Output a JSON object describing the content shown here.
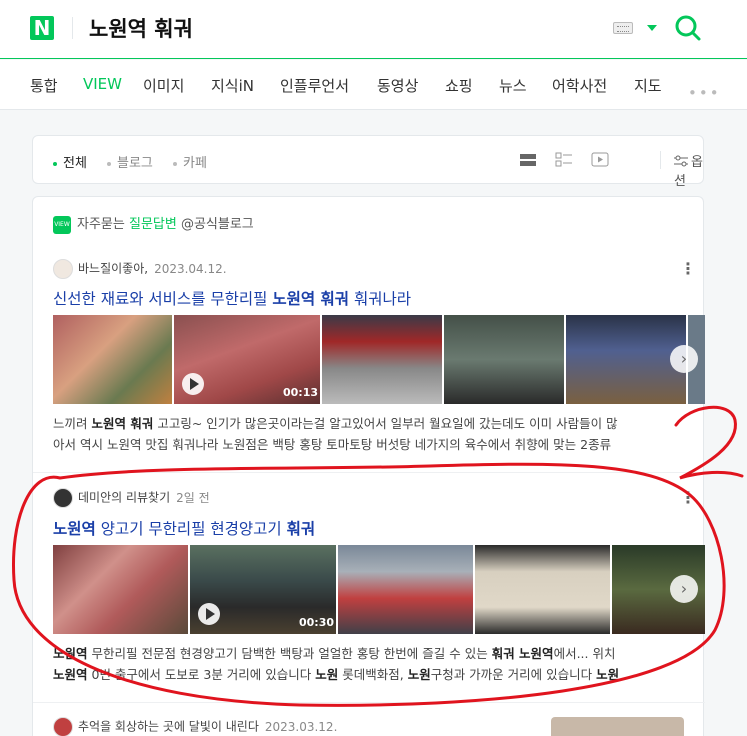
{
  "header": {
    "logo": "N",
    "query": "노원역 훠궈"
  },
  "tabs": [
    "통합",
    "VIEW",
    "이미지",
    "지식iN",
    "인플루언서",
    "동영상",
    "쇼핑",
    "뉴스",
    "어학사전",
    "지도"
  ],
  "tabs_more": "•••",
  "filters": {
    "items": [
      "전체",
      "블로그",
      "카페"
    ],
    "options_label": "옵션"
  },
  "faq": {
    "badge": "VIEW",
    "prefix": "자주묻는",
    "highlight": "질문답변",
    "suffix": "@공식블로그"
  },
  "results": [
    {
      "author": "바느질이좋아,",
      "date": "2023.04.12.",
      "title_pre": "신선한 재료와 서비스를 무한리필 ",
      "title_hl": "노원역 훠궈",
      "title_post": " 훠궈나라",
      "video_duration": "00:13",
      "desc_line1_pre": "느끼려 ",
      "desc_line1_hl": "노원역 훠궈",
      "desc_line1_post": " 고고링~ 인기가 많은곳이라는걸 알고있어서 일부러 월요일에 갔는데도 이미 사람들이 많",
      "desc_line2": "아서 역시 노원역 맛집 훠궈나라 노원점은 백탕 홍탕 토마토탕 버섯탕 네가지의 육수에서 취향에 맞는 2종류"
    },
    {
      "author": "데미안의 리뷰찾기",
      "date": "2일 전",
      "title_hl1": "노원역",
      "title_mid": " 양고기 무한리필 현경양고기 ",
      "title_hl2": "훠궈",
      "video_duration": "00:30",
      "desc_line1_hl": "노원역",
      "desc_line1_mid": " 무한리필 전문점 현경양고기 담백한 백탕과 얼얼한 홍탕 한번에 즐길 수 있는 ",
      "desc_line1_hl2": "훠궈 노원역",
      "desc_line1_post": "에서... 위치",
      "desc_line2_hl": "노원역",
      "desc_line2_mid": " 0번 출구에서 도보로 3분 거리에 있습니다 ",
      "desc_line2_hl2": "노원",
      "desc_line2_mid2": " 롯데백화점, ",
      "desc_line2_hl3": "노원",
      "desc_line2_post": "구청과 가까운 거리에 있습니다 ",
      "desc_line2_hl4": "노원"
    },
    {
      "author": "추억을 회상하는 곳에 달빛이 내린다",
      "date": "2023.03.12."
    }
  ],
  "annotation": {
    "label": "2",
    "color": "#e0141e"
  },
  "colors": {
    "accent": "#03c75a",
    "link": "#1a3fa8"
  }
}
